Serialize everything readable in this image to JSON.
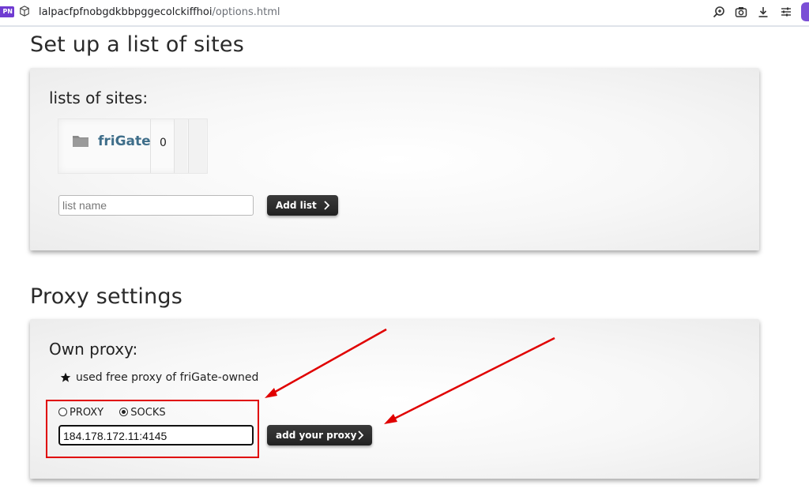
{
  "browser": {
    "vpn_badge": "PN",
    "url_host": "lalpacfpfnobgdkbbpggecolckiffhoi",
    "url_path": "/options.html",
    "toolbar_icons": [
      "zoom-icon",
      "camera-icon",
      "download-icon",
      "tune-icon",
      "extension-icon"
    ]
  },
  "sites": {
    "heading": "Set up a list of sites",
    "panel_title": "lists of sites:",
    "lists": [
      {
        "name": "friGate",
        "count": "0"
      }
    ],
    "input_placeholder": "list name",
    "add_button": "Add list"
  },
  "proxy": {
    "heading": "Proxy settings",
    "panel_title": "Own proxy:",
    "note": "used free proxy of friGate-owned",
    "radio_proxy": "PROXY",
    "radio_socks": "SOCKS",
    "selected": "SOCKS",
    "proxy_value": "184.178.172.11:4145",
    "add_button": "add your proxy"
  },
  "colors": {
    "annotation": "#e00000",
    "link": "#3f6e8a",
    "button": "#2a2a2a"
  }
}
